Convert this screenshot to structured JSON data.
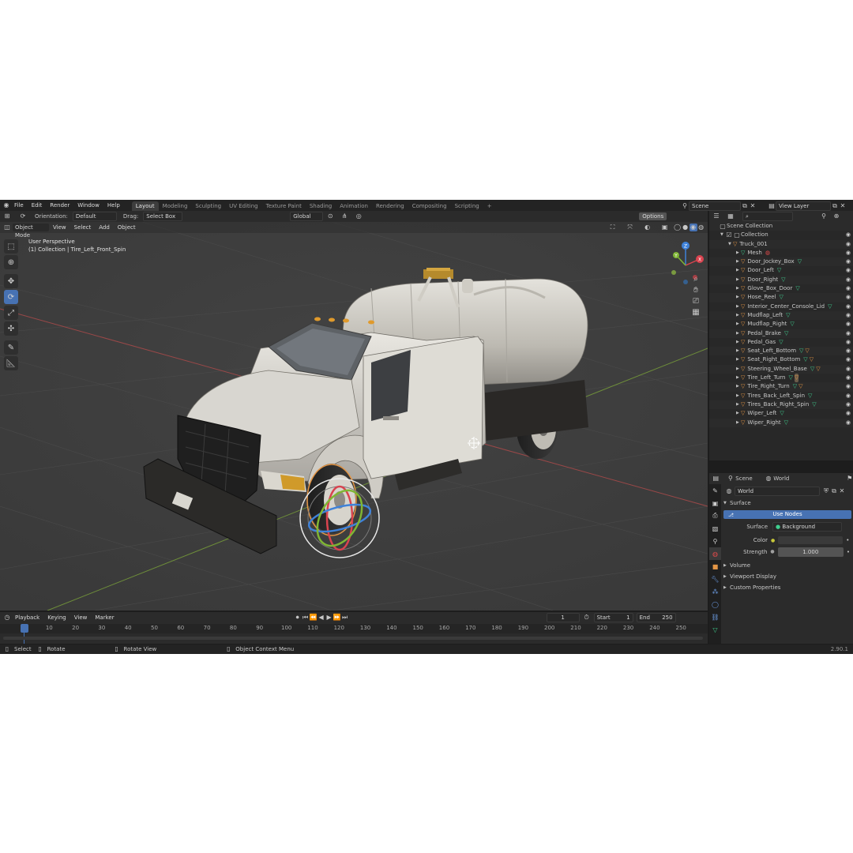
{
  "menu": {
    "file": "File",
    "edit": "Edit",
    "render": "Render",
    "window": "Window",
    "help": "Help"
  },
  "workspaces": [
    "Layout",
    "Modeling",
    "Sculpting",
    "UV Editing",
    "Texture Paint",
    "Shading",
    "Animation",
    "Rendering",
    "Compositing",
    "Scripting"
  ],
  "workspace_plus": "+",
  "scene_selector": {
    "value": "Scene"
  },
  "view_layer": {
    "value": "View Layer"
  },
  "toolbar": {
    "orientation_label": "Orientation:",
    "orientation_value": "Default",
    "drag_label": "Drag:",
    "drag_value": "Select Box",
    "transform_orientation": "Global",
    "options": "Options"
  },
  "header": {
    "mode": "Object Mode",
    "view": "View",
    "select": "Select",
    "add": "Add",
    "object": "Object"
  },
  "viewport": {
    "perspective": "User Perspective",
    "collection_info": "(1) Collection | Tire_Left_Front_Spin",
    "gizmo": {
      "x": "X",
      "y": "Y",
      "z": "Z"
    }
  },
  "outliner": {
    "scene_collection": "Scene Collection",
    "collection": "Collection",
    "root_object": "Truck_001",
    "items": [
      {
        "name": "Mesh",
        "extra": "mesh"
      },
      {
        "name": "Door_Jockey_Box",
        "extra": "g"
      },
      {
        "name": "Door_Left",
        "extra": "g"
      },
      {
        "name": "Door_Right",
        "extra": "g"
      },
      {
        "name": "Glove_Box_Door",
        "extra": "g"
      },
      {
        "name": "Hose_Reel",
        "extra": "g"
      },
      {
        "name": "Interior_Center_Console_Lid",
        "extra": "g"
      },
      {
        "name": "Mudflap_Left",
        "extra": "g"
      },
      {
        "name": "Mudflap_Right",
        "extra": "g"
      },
      {
        "name": "Pedal_Brake",
        "extra": "g"
      },
      {
        "name": "Pedal_Gas",
        "extra": "g"
      },
      {
        "name": "Seat_Left_Bottom",
        "extra": "go"
      },
      {
        "name": "Seat_Right_Bottom",
        "extra": "go"
      },
      {
        "name": "Steering_Wheel_Base",
        "extra": "go"
      },
      {
        "name": "Tire_Left_Turn",
        "extra": "gsel"
      },
      {
        "name": "Tire_Right_Turn",
        "extra": "go"
      },
      {
        "name": "Tires_Back_Left_Spin",
        "extra": "g"
      },
      {
        "name": "Tires_Back_Right_Spin",
        "extra": "g"
      },
      {
        "name": "Wiper_Left",
        "extra": "g"
      },
      {
        "name": "Wiper_Right",
        "extra": "g"
      }
    ]
  },
  "properties": {
    "breadcrumb_scene": "Scene",
    "breadcrumb_world": "World",
    "world_name": "World",
    "surface_panel": "Surface",
    "use_nodes": "Use Nodes",
    "surface_label": "Surface",
    "surface_value": "Background",
    "color_label": "Color",
    "strength_label": "Strength",
    "strength_value": "1.000",
    "panels": [
      "Volume",
      "Viewport Display",
      "Custom Properties"
    ]
  },
  "timeline": {
    "playback": "Playback",
    "keying": "Keying",
    "view": "View",
    "marker": "Marker",
    "current_frame": "1",
    "start_label": "Start",
    "start_value": "1",
    "end_label": "End",
    "end_value": "250",
    "ticks": [
      "1",
      "10",
      "20",
      "30",
      "40",
      "50",
      "60",
      "70",
      "80",
      "90",
      "100",
      "110",
      "120",
      "130",
      "140",
      "150",
      "160",
      "170",
      "180",
      "190",
      "200",
      "210",
      "220",
      "230",
      "240",
      "250"
    ]
  },
  "statusbar": {
    "select": "Select",
    "rotate": "Rotate",
    "rotate_view": "Rotate View",
    "context_menu": "Object Context Menu",
    "version": "2.90.1"
  },
  "colors": {
    "accent": "#4772b3",
    "outliner_mesh": "#3fcf8f",
    "outliner_material": "#e39545",
    "x_axis": "#d9434f",
    "y_axis": "#7fb534",
    "z_axis": "#3f82d9"
  }
}
